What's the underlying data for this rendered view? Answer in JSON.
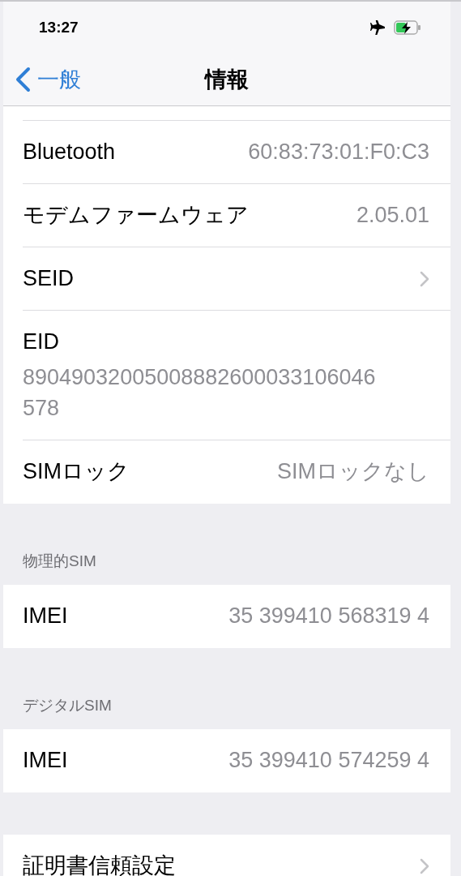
{
  "status_bar": {
    "time": "13:27"
  },
  "nav": {
    "back_label": "一般",
    "title": "情報"
  },
  "groups": [
    {
      "rows": [
        {
          "kind": "value",
          "label": "Bluetooth",
          "value": "60:83:73:01:F0:C3"
        },
        {
          "kind": "value",
          "label": "モデムファームウェア",
          "value": "2.05.01"
        },
        {
          "kind": "disclosure",
          "label": "SEID"
        },
        {
          "kind": "stacked",
          "label": "EID",
          "value": "89049032005008882600033106046578"
        },
        {
          "kind": "value",
          "label": "SIMロック",
          "value": "SIMロックなし"
        }
      ]
    },
    {
      "header": "物理的SIM",
      "rows": [
        {
          "kind": "value",
          "label": "IMEI",
          "value": "35 399410 568319 4"
        }
      ]
    },
    {
      "header": "デジタルSIM",
      "rows": [
        {
          "kind": "value",
          "label": "IMEI",
          "value": "35 399410 574259 4"
        }
      ]
    },
    {
      "rows": [
        {
          "kind": "disclosure",
          "label": "証明書信頼設定"
        }
      ]
    }
  ]
}
